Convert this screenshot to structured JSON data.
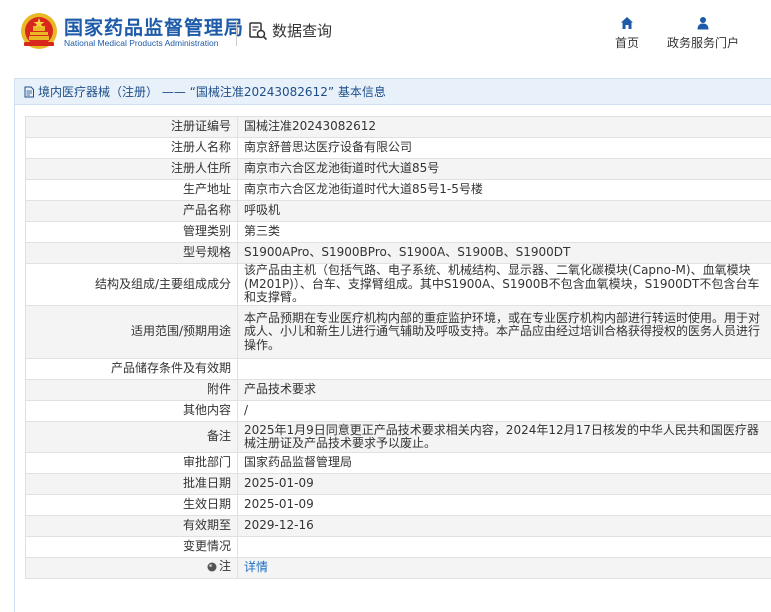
{
  "header": {
    "brand_cn": "国家药品监督管理局",
    "brand_en": "National Medical Products Administration",
    "query_label": "数据查询",
    "nav": [
      {
        "label": "首页",
        "icon": "home-icon"
      },
      {
        "label": "政务服务门户",
        "icon": "user-icon"
      }
    ]
  },
  "panel": {
    "title": "境内医疗器械（注册） —— “国械注准20243082612” 基本信息"
  },
  "rows": [
    {
      "key": "注册证编号",
      "value": "国械注准20243082612"
    },
    {
      "key": "注册人名称",
      "value": "南京舒普思达医疗设备有限公司"
    },
    {
      "key": "注册人住所",
      "value": "南京市六合区龙池街道时代大道85号"
    },
    {
      "key": "生产地址",
      "value": "南京市六合区龙池街道时代大道85号1-5号楼"
    },
    {
      "key": "产品名称",
      "value": "呼吸机"
    },
    {
      "key": "管理类别",
      "value": "第三类"
    },
    {
      "key": "型号规格",
      "value": "S1900APro、S1900BPro、S1900A、S1900B、S1900DT"
    },
    {
      "key": "结构及组成/主要组成成分",
      "value": "该产品由主机（包括气路、电子系统、机械结构、显示器、二氧化碳模块(Capno-M)、血氧模块(M201P)）、台车、支撑臂组成。其中S1900A、S1900B不包含血氧模块，S1900DT不包含台车和支撑臂。"
    },
    {
      "key": "适用范围/预期用途",
      "value": "本产品预期在专业医疗机构内部的重症监护环境，或在专业医疗机构内部进行转运时使用。用于对成人、小儿和新生儿进行通气辅助及呼吸支持。本产品应由经过培训合格获得授权的医务人员进行操作。"
    },
    {
      "key": "产品储存条件及有效期",
      "value": ""
    },
    {
      "key": "附件",
      "value": "产品技术要求"
    },
    {
      "key": "其他内容",
      "value": "/"
    },
    {
      "key": "备注",
      "value": "2025年1月9日同意更正产品技术要求相关内容，2024年12月17日核发的中华人民共和国医疗器械注册证及产品技术要求予以废止。"
    },
    {
      "key": "审批部门",
      "value": "国家药品监督管理局"
    },
    {
      "key": "批准日期",
      "value": "2025-01-09"
    },
    {
      "key": "生效日期",
      "value": "2025-01-09"
    },
    {
      "key": "有效期至",
      "value": "2029-12-16"
    },
    {
      "key": "变更情况",
      "value": ""
    }
  ],
  "note_row": {
    "key": "注",
    "icon": "note-icon",
    "link": "详情"
  },
  "colors": {
    "brand": "#1d5aa8",
    "link": "#1d6fc4",
    "panel_title_bg": "#e8f1fa",
    "stripe": "#f4f4f4"
  }
}
